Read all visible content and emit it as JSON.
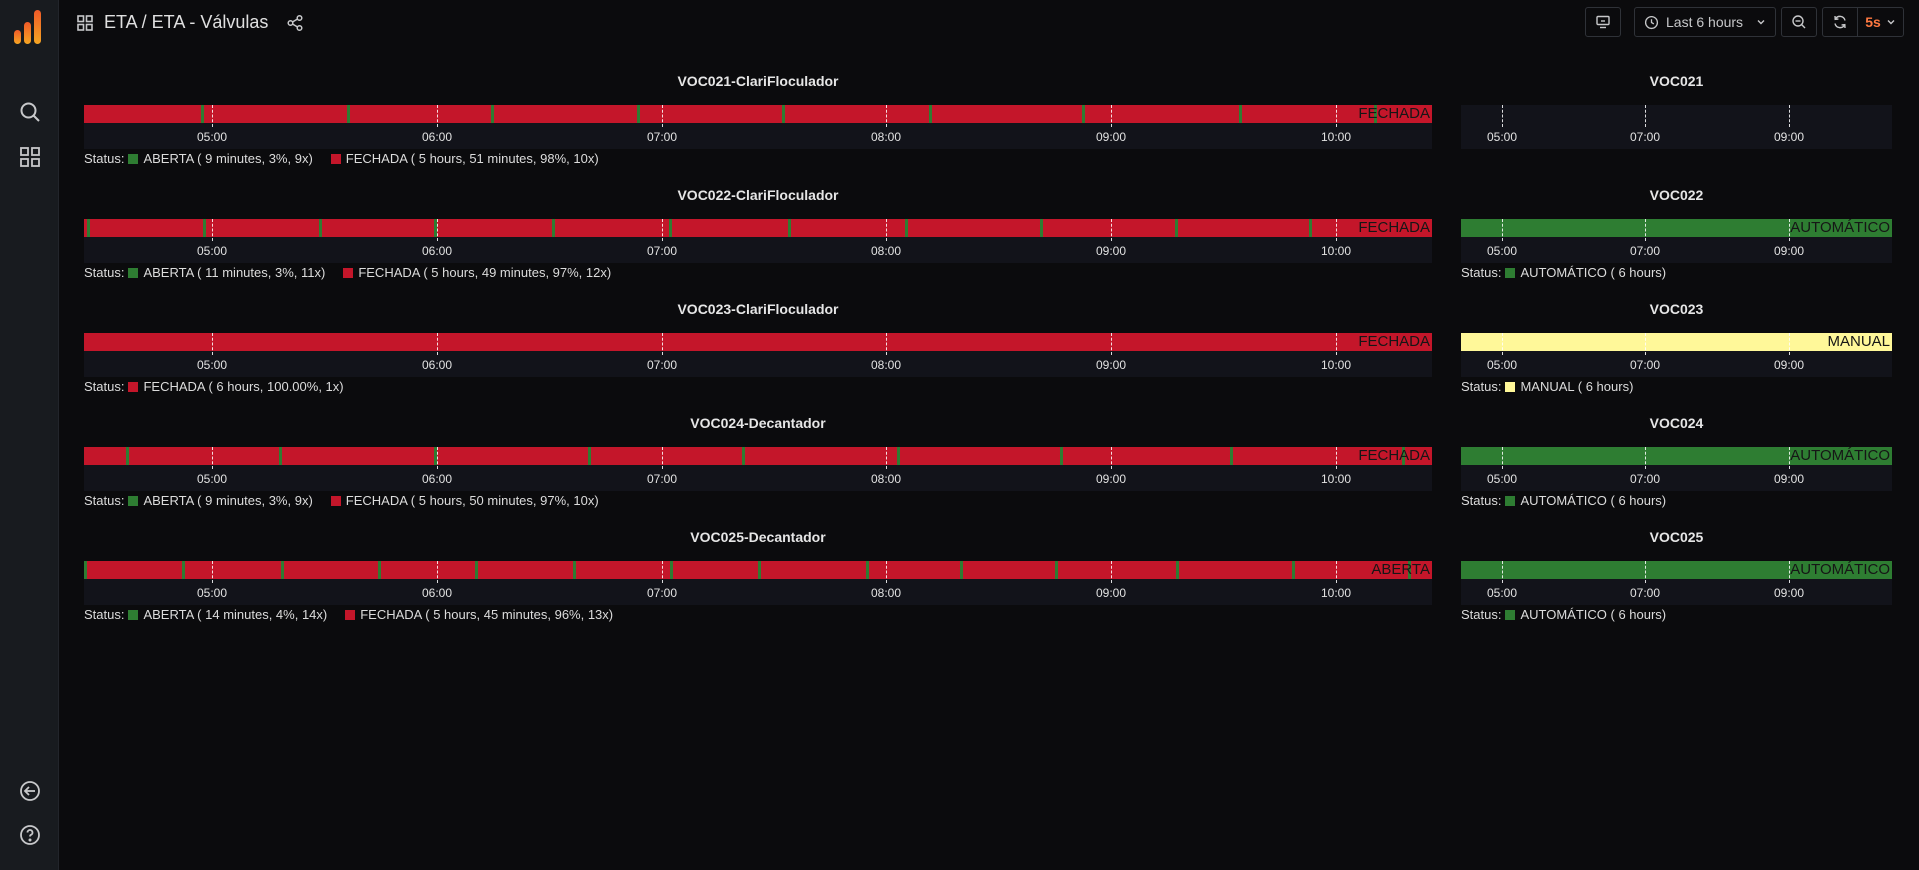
{
  "colors": {
    "aberta": "#2e7d32",
    "fechada": "#c4162a",
    "automatico": "#2e7d32",
    "manual": "#fff899"
  },
  "nav": {
    "breadcrumb": "ETA / ETA - Válvulas",
    "time_range": "Last 6 hours",
    "refresh_interval": "5s"
  },
  "panels": [
    {
      "title": "VOC021-ClariFloculador",
      "state_label": "FECHADA",
      "legend_prefix": "Status:",
      "legend": [
        {
          "text": "ABERTA ( 9 minutes, 3%, 9x)",
          "color": "#2e7d32"
        },
        {
          "text": "FECHADA ( 5 hours, 51 minutes, 98%, 10x)",
          "color": "#c4162a"
        }
      ],
      "base_color": "#c4162a",
      "events": [
        0.087,
        0.195,
        0.302,
        0.41,
        0.518,
        0.627,
        0.74,
        0.857,
        0.957
      ],
      "ticks": [
        "05:00",
        "06:00",
        "07:00",
        "08:00",
        "09:00",
        "10:00"
      ],
      "tick_pos": [
        0.0952,
        0.262,
        0.4286,
        0.5952,
        0.762,
        0.9286
      ]
    },
    {
      "title": "VOC022-ClariFloculador",
      "state_label": "FECHADA",
      "legend_prefix": "Status:",
      "legend": [
        {
          "text": "ABERTA ( 11 minutes, 3%, 11x)",
          "color": "#2e7d32"
        },
        {
          "text": "FECHADA ( 5 hours, 49 minutes, 97%, 12x)",
          "color": "#c4162a"
        }
      ],
      "base_color": "#c4162a",
      "events": [
        0.002,
        0.088,
        0.174,
        0.26,
        0.347,
        0.434,
        0.522,
        0.609,
        0.709,
        0.809,
        0.909
      ],
      "ticks": [
        "05:00",
        "06:00",
        "07:00",
        "08:00",
        "09:00",
        "10:00"
      ],
      "tick_pos": [
        0.0952,
        0.262,
        0.4286,
        0.5952,
        0.762,
        0.9286
      ]
    },
    {
      "title": "VOC023-ClariFloculador",
      "state_label": "FECHADA",
      "legend_prefix": "Status:",
      "legend": [
        {
          "text": "FECHADA ( 6 hours, 100.00%, 1x)",
          "color": "#c4162a"
        }
      ],
      "base_color": "#c4162a",
      "events": [],
      "ticks": [
        "05:00",
        "06:00",
        "07:00",
        "08:00",
        "09:00",
        "10:00"
      ],
      "tick_pos": [
        0.0952,
        0.262,
        0.4286,
        0.5952,
        0.762,
        0.9286
      ]
    },
    {
      "title": "VOC024-Decantador",
      "state_label": "FECHADA",
      "legend_prefix": "Status:",
      "legend": [
        {
          "text": "ABERTA ( 9 minutes, 3%, 9x)",
          "color": "#2e7d32"
        },
        {
          "text": "FECHADA ( 5 hours, 50 minutes, 97%, 10x)",
          "color": "#c4162a"
        }
      ],
      "base_color": "#c4162a",
      "events": [
        0.031,
        0.145,
        0.26,
        0.374,
        0.488,
        0.603,
        0.724,
        0.85,
        0.978
      ],
      "ticks": [
        "05:00",
        "06:00",
        "07:00",
        "08:00",
        "09:00",
        "10:00"
      ],
      "tick_pos": [
        0.0952,
        0.262,
        0.4286,
        0.5952,
        0.762,
        0.9286
      ]
    },
    {
      "title": "VOC025-Decantador",
      "state_label": "ABERTA",
      "legend_prefix": "Status:",
      "legend": [
        {
          "text": "ABERTA ( 14 minutes, 4%, 14x)",
          "color": "#2e7d32"
        },
        {
          "text": "FECHADA ( 5 hours, 45 minutes, 96%, 13x)",
          "color": "#c4162a"
        }
      ],
      "base_color": "#c4162a",
      "events": [
        0.0,
        0.073,
        0.146,
        0.218,
        0.29,
        0.363,
        0.435,
        0.5,
        0.58,
        0.65,
        0.72,
        0.81,
        0.896,
        0.982
      ],
      "ticks": [
        "05:00",
        "06:00",
        "07:00",
        "08:00",
        "09:00",
        "10:00"
      ],
      "tick_pos": [
        0.0952,
        0.262,
        0.4286,
        0.5952,
        0.762,
        0.9286
      ]
    }
  ],
  "side_panels": [
    {
      "title": "VOC021",
      "state_label": "",
      "legend": [],
      "base_color": "",
      "ticks": [
        "05:00",
        "07:00",
        "09:00"
      ],
      "tick_pos": [
        0.095,
        0.428,
        0.762
      ]
    },
    {
      "title": "VOC022",
      "state_label": "AUTOMÁTICO",
      "legend_prefix": "Status:",
      "legend": [
        {
          "text": "AUTOMÁTICO ( 6 hours)",
          "color": "#2e7d32"
        }
      ],
      "base_color": "#2e7d32",
      "ticks": [
        "05:00",
        "07:00",
        "09:00"
      ],
      "tick_pos": [
        0.095,
        0.428,
        0.762
      ]
    },
    {
      "title": "VOC023",
      "state_label": "MANUAL",
      "legend_prefix": "Status:",
      "legend": [
        {
          "text": "MANUAL ( 6 hours)",
          "color": "#fff899"
        }
      ],
      "base_color": "#fff899",
      "ticks": [
        "05:00",
        "07:00",
        "09:00"
      ],
      "tick_pos": [
        0.095,
        0.428,
        0.762
      ]
    },
    {
      "title": "VOC024",
      "state_label": "AUTOMÁTICO",
      "legend_prefix": "Status:",
      "legend": [
        {
          "text": "AUTOMÁTICO ( 6 hours)",
          "color": "#2e7d32"
        }
      ],
      "base_color": "#2e7d32",
      "ticks": [
        "05:00",
        "07:00",
        "09:00"
      ],
      "tick_pos": [
        0.095,
        0.428,
        0.762
      ]
    },
    {
      "title": "VOC025",
      "state_label": "AUTOMÁTICO",
      "legend_prefix": "Status:",
      "legend": [
        {
          "text": "AUTOMÁTICO ( 6 hours)",
          "color": "#2e7d32"
        }
      ],
      "base_color": "#2e7d32",
      "ticks": [
        "05:00",
        "07:00",
        "09:00"
      ],
      "tick_pos": [
        0.095,
        0.428,
        0.762
      ]
    }
  ]
}
